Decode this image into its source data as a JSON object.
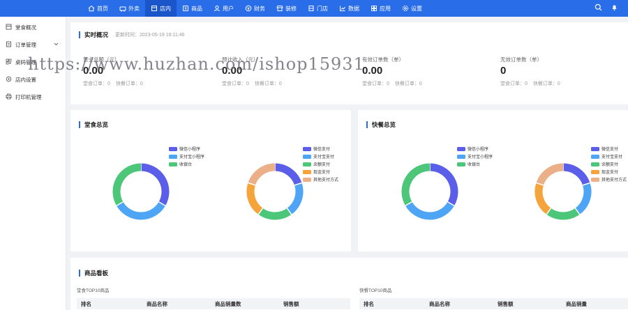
{
  "nav": {
    "items": [
      {
        "label": "首页",
        "icon": "home-icon"
      },
      {
        "label": "外卖",
        "icon": "takeout-icon"
      },
      {
        "label": "店内",
        "icon": "store-icon"
      },
      {
        "label": "商品",
        "icon": "product-icon"
      },
      {
        "label": "用户",
        "icon": "user-icon"
      },
      {
        "label": "财务",
        "icon": "finance-icon"
      },
      {
        "label": "装修",
        "icon": "decor-icon"
      },
      {
        "label": "门店",
        "icon": "shop-icon"
      },
      {
        "label": "数据",
        "icon": "chart-icon"
      },
      {
        "label": "应用",
        "icon": "apps-icon"
      },
      {
        "label": "设置",
        "icon": "gear-icon"
      }
    ],
    "active_index": 2,
    "color": "#2a6de8"
  },
  "sidebar": {
    "items": [
      {
        "label": "堂食概况",
        "icon": "overview-icon"
      },
      {
        "label": "订单管理",
        "icon": "order-icon",
        "has_chevron": true
      },
      {
        "label": "桌码管理",
        "icon": "qrcode-icon"
      },
      {
        "label": "店内设置",
        "icon": "settings-icon"
      },
      {
        "label": "打印机管理",
        "icon": "printer-icon"
      }
    ]
  },
  "realtime": {
    "title": "实时概况",
    "update_label": "更新时间：2023-05-19 16:11:46",
    "stats": [
      {
        "label": "营业总额（元）",
        "value": "0.00",
        "sub1": "堂食订单：0",
        "sub2": "快餐订单：0"
      },
      {
        "label": "预计收入（元）",
        "value": "0.00",
        "sub1": "堂食订单：0",
        "sub2": "快餐订单：0"
      },
      {
        "label": "有效订单数（单）",
        "value": "0.00",
        "sub1": "堂食订单：0",
        "sub2": "快餐订单：0"
      },
      {
        "label": "无效订单数（单）",
        "value": "0",
        "sub1": "堂食订单：0",
        "sub2": "快餐订单：0"
      }
    ]
  },
  "dine_in_overview": {
    "title": "堂食总览",
    "chart_left": {
      "legend": [
        "微信小程序",
        "支付宝小程序",
        "收银台"
      ],
      "values": [
        1,
        1,
        1
      ],
      "colors": [
        "#5b5ee8",
        "#4fa5f5",
        "#4cc77a"
      ]
    },
    "chart_right": {
      "legend": [
        "微信支付",
        "支付宝支付",
        "余额支付",
        "现金支付",
        "其他支付方式"
      ],
      "values": [
        1,
        1,
        1,
        1,
        1
      ],
      "colors": [
        "#5b5ee8",
        "#4fa5f5",
        "#4cc77a",
        "#f5a43c",
        "#ebb088"
      ]
    }
  },
  "fast_overview": {
    "title": "快餐总览",
    "chart_left": {
      "legend": [
        "微信小程序",
        "支付宝小程序",
        "收银台"
      ],
      "values": [
        1,
        1,
        1
      ],
      "colors": [
        "#5b5ee8",
        "#4fa5f5",
        "#4cc77a"
      ]
    },
    "chart_right": {
      "legend": [
        "微信支付",
        "支付宝支付",
        "余额支付",
        "现金支付",
        "其他支付方式"
      ],
      "values": [
        1,
        1,
        1,
        1,
        1
      ],
      "colors": [
        "#5b5ee8",
        "#4fa5f5",
        "#4cc77a",
        "#f5a43c",
        "#ebb088"
      ]
    }
  },
  "goods_board": {
    "title": "商品看板",
    "left": {
      "subtitle": "堂食TOP10商品",
      "columns": [
        "排名",
        "商品名称",
        "商品销量数",
        "销售额"
      ]
    },
    "right": {
      "subtitle": "快餐TOP10商品",
      "columns": [
        "排名",
        "商品名称",
        "销售额",
        "商品销量"
      ]
    }
  },
  "watermark": "https://www.huzhan.com/ishop15931"
}
